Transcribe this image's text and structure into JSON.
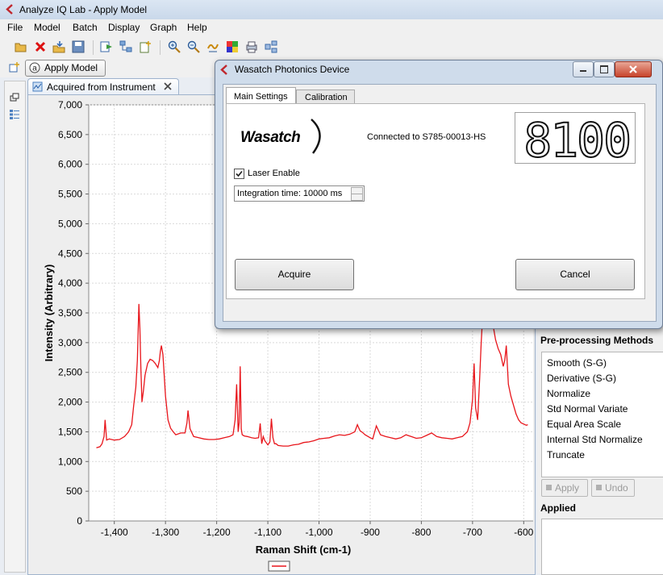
{
  "window": {
    "title": "Analyze IQ Lab - Apply Model"
  },
  "menu": [
    "File",
    "Model",
    "Batch",
    "Display",
    "Graph",
    "Help"
  ],
  "perspective": {
    "label": "Apply Model"
  },
  "editor": {
    "tab_label": "Acquired from Instrument"
  },
  "chart_data": {
    "type": "line",
    "xlabel": "Raman Shift (cm-1)",
    "ylabel": "Intensity (Arbitrary)",
    "xlim": [
      -1450,
      -580
    ],
    "ylim": [
      0,
      7000
    ],
    "x_ticks": [
      -1400,
      -1300,
      -1200,
      -1100,
      -1000,
      -900,
      -800,
      -700,
      -600
    ],
    "x_tick_labels": [
      "-1,400",
      "-1,300",
      "-1,200",
      "-1,100",
      "-1,000",
      "-900",
      "-800",
      "-700",
      "-600"
    ],
    "y_ticks": [
      0,
      500,
      1000,
      1500,
      2000,
      2500,
      3000,
      3500,
      4000,
      4500,
      5000,
      5500,
      6000,
      6500,
      7000
    ],
    "y_tick_labels": [
      "0",
      "500",
      "1,000",
      "1,500",
      "2,000",
      "2,500",
      "3,000",
      "3,500",
      "4,000",
      "4,500",
      "5,000",
      "5,500",
      "6,000",
      "6,500",
      "7,000"
    ],
    "grid": true,
    "legend": "bottom",
    "series": [
      {
        "color": "#e8151b",
        "x": [
          -1435,
          -1428,
          -1424,
          -1420,
          -1418,
          -1415,
          -1410,
          -1400,
          -1390,
          -1380,
          -1372,
          -1366,
          -1362,
          -1358,
          -1355,
          -1352,
          -1350,
          -1348,
          -1346,
          -1343,
          -1340,
          -1335,
          -1330,
          -1325,
          -1320,
          -1315,
          -1312,
          -1310,
          -1308,
          -1305,
          -1300,
          -1295,
          -1290,
          -1285,
          -1280,
          -1270,
          -1262,
          -1258,
          -1256,
          -1252,
          -1245,
          -1235,
          -1225,
          -1215,
          -1205,
          -1195,
          -1185,
          -1175,
          -1168,
          -1164,
          -1161,
          -1158,
          -1156,
          -1154,
          -1152,
          -1150,
          -1146,
          -1140,
          -1132,
          -1125,
          -1118,
          -1115,
          -1112,
          -1109,
          -1106,
          -1100,
          -1096,
          -1093,
          -1090,
          -1087,
          -1084,
          -1080,
          -1070,
          -1060,
          -1050,
          -1040,
          -1030,
          -1020,
          -1010,
          -1000,
          -990,
          -980,
          -970,
          -960,
          -950,
          -940,
          -930,
          -925,
          -920,
          -915,
          -910,
          -900,
          -895,
          -888,
          -880,
          -870,
          -860,
          -850,
          -840,
          -830,
          -820,
          -810,
          -800,
          -790,
          -780,
          -770,
          -760,
          -750,
          -740,
          -730,
          -720,
          -710,
          -705,
          -700,
          -697,
          -694,
          -690,
          -686,
          -683,
          -680,
          -678,
          -675,
          -672,
          -668,
          -664,
          -660,
          -655,
          -650,
          -645,
          -640,
          -637,
          -634,
          -630,
          -625,
          -620,
          -615,
          -610,
          -605,
          -600,
          -595,
          -592
        ],
        "values": [
          1230,
          1250,
          1300,
          1420,
          1700,
          1360,
          1380,
          1360,
          1370,
          1420,
          1500,
          1620,
          1950,
          2250,
          2700,
          3650,
          3250,
          2550,
          2000,
          2200,
          2450,
          2650,
          2720,
          2700,
          2650,
          2580,
          2700,
          2850,
          2950,
          2800,
          2100,
          1700,
          1560,
          1500,
          1450,
          1480,
          1480,
          1650,
          1860,
          1550,
          1420,
          1400,
          1380,
          1370,
          1370,
          1380,
          1400,
          1420,
          1450,
          1700,
          2300,
          1500,
          1650,
          2600,
          1550,
          1450,
          1430,
          1420,
          1400,
          1390,
          1400,
          1640,
          1300,
          1420,
          1350,
          1280,
          1330,
          1720,
          1400,
          1300,
          1300,
          1270,
          1260,
          1260,
          1280,
          1290,
          1320,
          1330,
          1350,
          1380,
          1390,
          1400,
          1430,
          1450,
          1440,
          1460,
          1500,
          1620,
          1520,
          1490,
          1450,
          1400,
          1380,
          1600,
          1450,
          1420,
          1400,
          1380,
          1400,
          1450,
          1420,
          1390,
          1400,
          1440,
          1480,
          1420,
          1400,
          1390,
          1380,
          1400,
          1420,
          1500,
          1650,
          2050,
          2650,
          1900,
          1700,
          2400,
          3000,
          3500,
          3700,
          3700,
          3700,
          3700,
          3700,
          3300,
          3050,
          2900,
          2800,
          2600,
          2700,
          2950,
          2300,
          2100,
          1950,
          1800,
          1700,
          1650,
          1630,
          1610,
          1620
        ]
      }
    ]
  },
  "right_panel": {
    "section_title": "Pre-processing Methods",
    "items": [
      "Smooth (S-G)",
      "Derivative (S-G)",
      "Normalize",
      "Std Normal Variate",
      "Equal Area Scale",
      "Internal Std Normalize",
      "Truncate"
    ],
    "apply_label": "Apply",
    "undo_label": "Undo",
    "applied_title": "Applied"
  },
  "dialog": {
    "title": "Wasatch Photonics Device",
    "tabs": [
      "Main Settings",
      "Calibration"
    ],
    "logo_text": "Wasatch",
    "connection_text": "Connected to S785-00013-HS",
    "lcd_value": "8100",
    "laser_enable_label": "Laser Enable",
    "laser_enabled": true,
    "integration_label": "Integration time: 10000 ms",
    "acquire_label": "Acquire",
    "cancel_label": "Cancel"
  }
}
